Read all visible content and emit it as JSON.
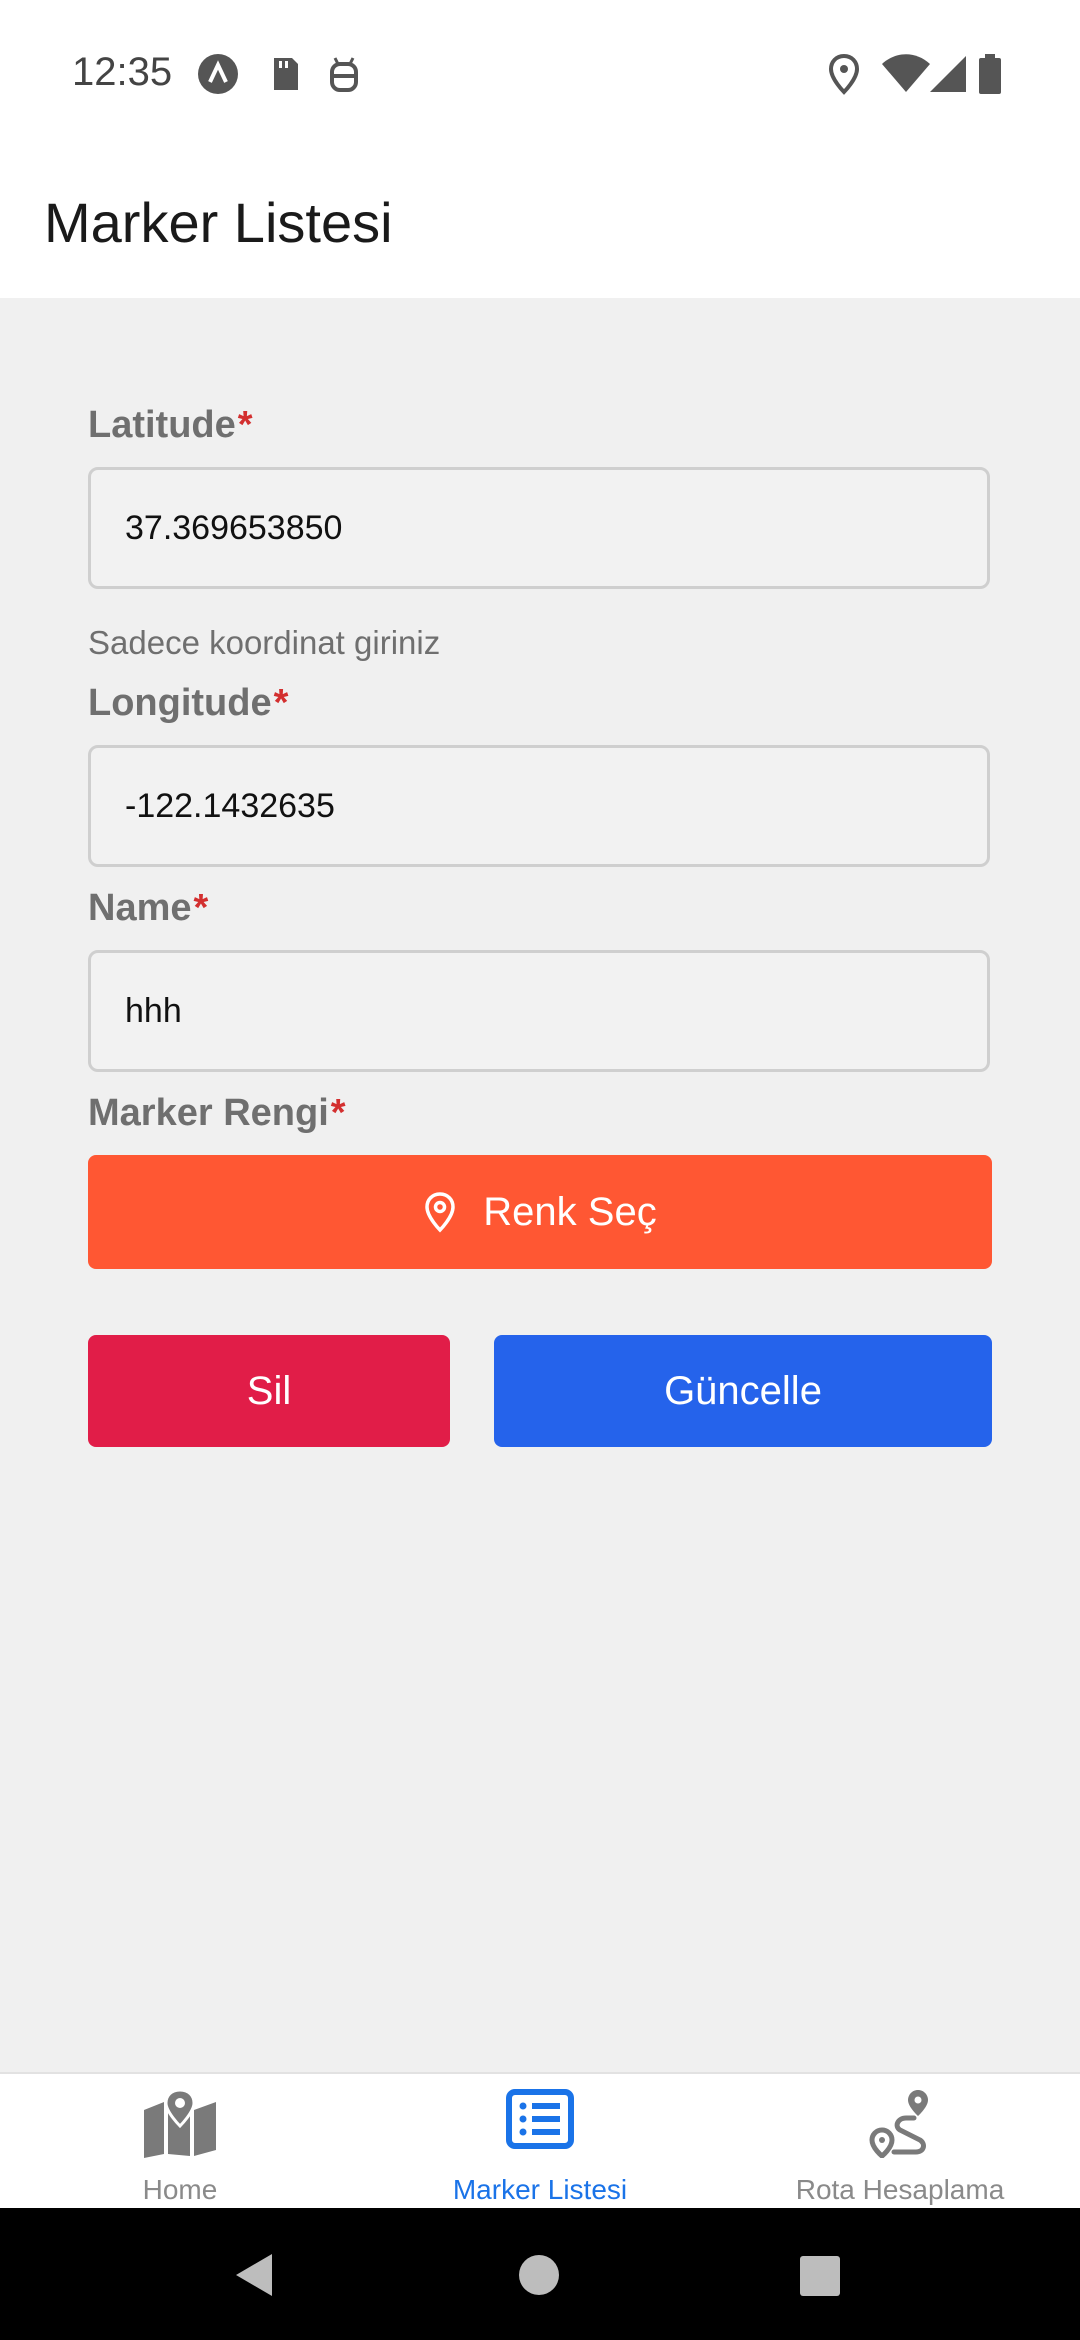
{
  "status_bar": {
    "time": "12:35",
    "left_icons": [
      "app-a-icon",
      "sd-card-icon",
      "robot-icon"
    ],
    "right_icons": [
      "location-icon",
      "wifi-icon",
      "signal-icon",
      "battery-icon"
    ]
  },
  "header": {
    "title": "Marker Listesi"
  },
  "form": {
    "latitude": {
      "label": "Latitude",
      "required": "*",
      "value": "37.369653850",
      "helper": "Sadece koordinat giriniz"
    },
    "longitude": {
      "label": "Longitude",
      "required": "*",
      "value": "-122.1432635"
    },
    "name": {
      "label": "Name",
      "required": "*",
      "value": "hhh"
    },
    "marker_color": {
      "label": "Marker Rengi",
      "required": "*",
      "button_label": "Renk Seç",
      "button_icon": "pin-icon",
      "color": "#ff5733"
    }
  },
  "actions": {
    "delete_label": "Sil",
    "delete_color": "#e11d48",
    "update_label": "Güncelle",
    "update_color": "#2563eb"
  },
  "bottom_nav": {
    "active_color": "#1a73e8",
    "items": [
      {
        "label": "Home",
        "icon": "map-icon"
      },
      {
        "label": "Marker Listesi",
        "icon": "list-icon"
      },
      {
        "label": "Rota Hesaplama",
        "icon": "route-icon"
      }
    ]
  },
  "system_nav": {
    "icons": [
      "back-icon",
      "home-circle-icon",
      "recents-icon"
    ]
  }
}
